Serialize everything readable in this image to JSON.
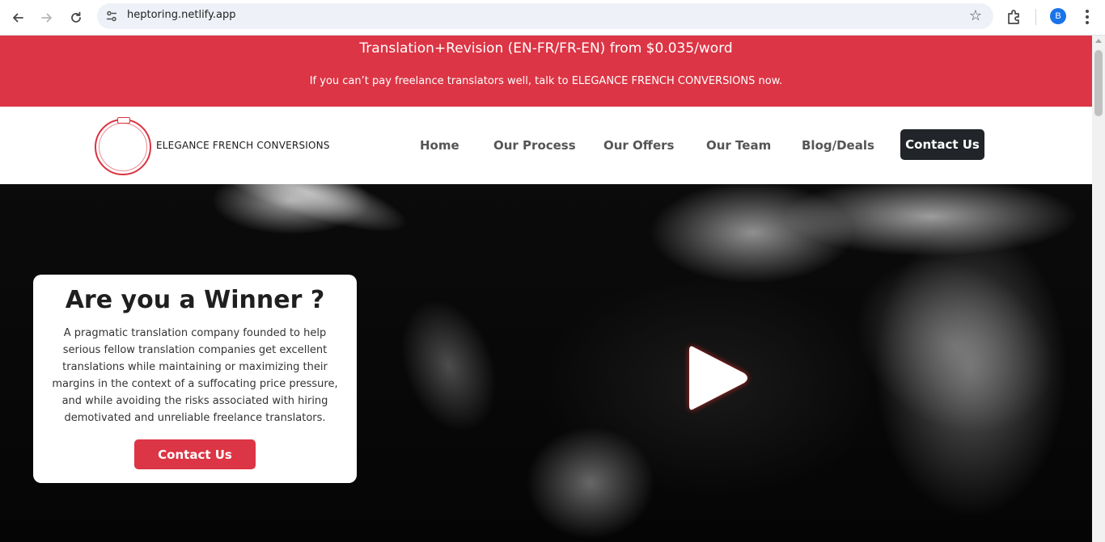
{
  "browser": {
    "url": "heptoring.netlify.app",
    "profile_initial": "B",
    "icons": [
      "back-icon",
      "forward-icon",
      "reload-icon",
      "site-settings-icon",
      "bookmark-star-icon",
      "extensions-icon",
      "menu-icon"
    ]
  },
  "banner": {
    "title": "Translation+Revision (EN-FR/FR-EN) from $0.035/word",
    "subtitle": "If you can’t pay freelance translators well, talk to ELEGANCE FRENCH CONVERSIONS now.",
    "color": "#dc3545"
  },
  "header": {
    "brand": "ELEGANCE FRENCH CONVERSIONS",
    "nav": [
      {
        "label": "Home"
      },
      {
        "label": "Our Process"
      },
      {
        "label": "Our Offers"
      },
      {
        "label": "Our Team"
      },
      {
        "label": "Blog/Deals"
      }
    ],
    "cta_label": "Contact Us"
  },
  "hero": {
    "title": "Are you a Winner ?",
    "text": "A pragmatic translation company founded to help serious fellow translation companies get excellent translations while maintaining or maximizing their margins in the context of a suffocating price pressure, and while avoiding the risks associated with hiring demotivated and unreliable freelance translators.",
    "cta_label": "Contact Us",
    "accent": "#dc3545"
  }
}
